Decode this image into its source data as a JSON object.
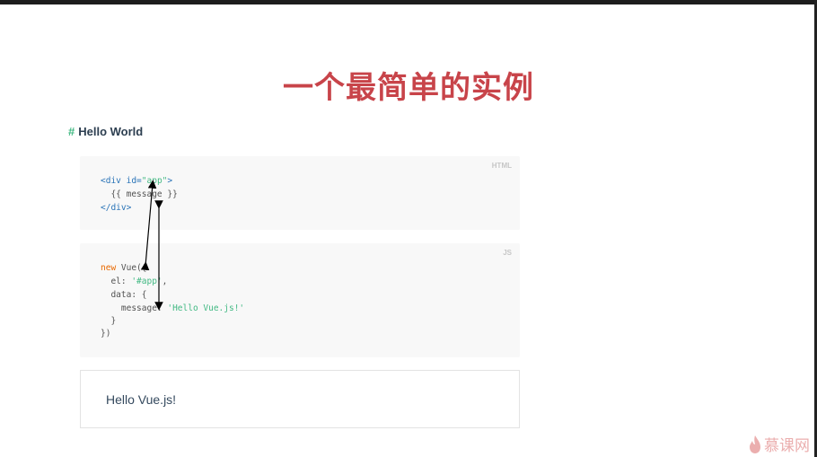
{
  "slide": {
    "title": "一个最简单的实例"
  },
  "section": {
    "hash": "#",
    "heading": "Hello World"
  },
  "html_block": {
    "lang": "HTML",
    "line1": {
      "open": "<div ",
      "attr": "id=",
      "value": "\"app\"",
      "close": ">"
    },
    "line2": "  {{ message }}",
    "line3": "</div>"
  },
  "js_block": {
    "lang": "JS",
    "line1": {
      "kw": "new",
      "rest": " Vue({"
    },
    "line2": {
      "prefix": "  el: ",
      "value": "'#app'",
      "suffix": ","
    },
    "line3": "  data: {",
    "line4": {
      "prefix": "    message: ",
      "value": "'Hello Vue.js!'"
    },
    "line5": "  }",
    "line6": "})"
  },
  "result": {
    "text": "Hello Vue.js!"
  },
  "watermark": {
    "text": "慕课网",
    "icon": "flame-icon"
  },
  "colors": {
    "title": "#c8444a",
    "accent": "#42b983",
    "tag": "#2973b7",
    "keyword": "#e96900"
  }
}
